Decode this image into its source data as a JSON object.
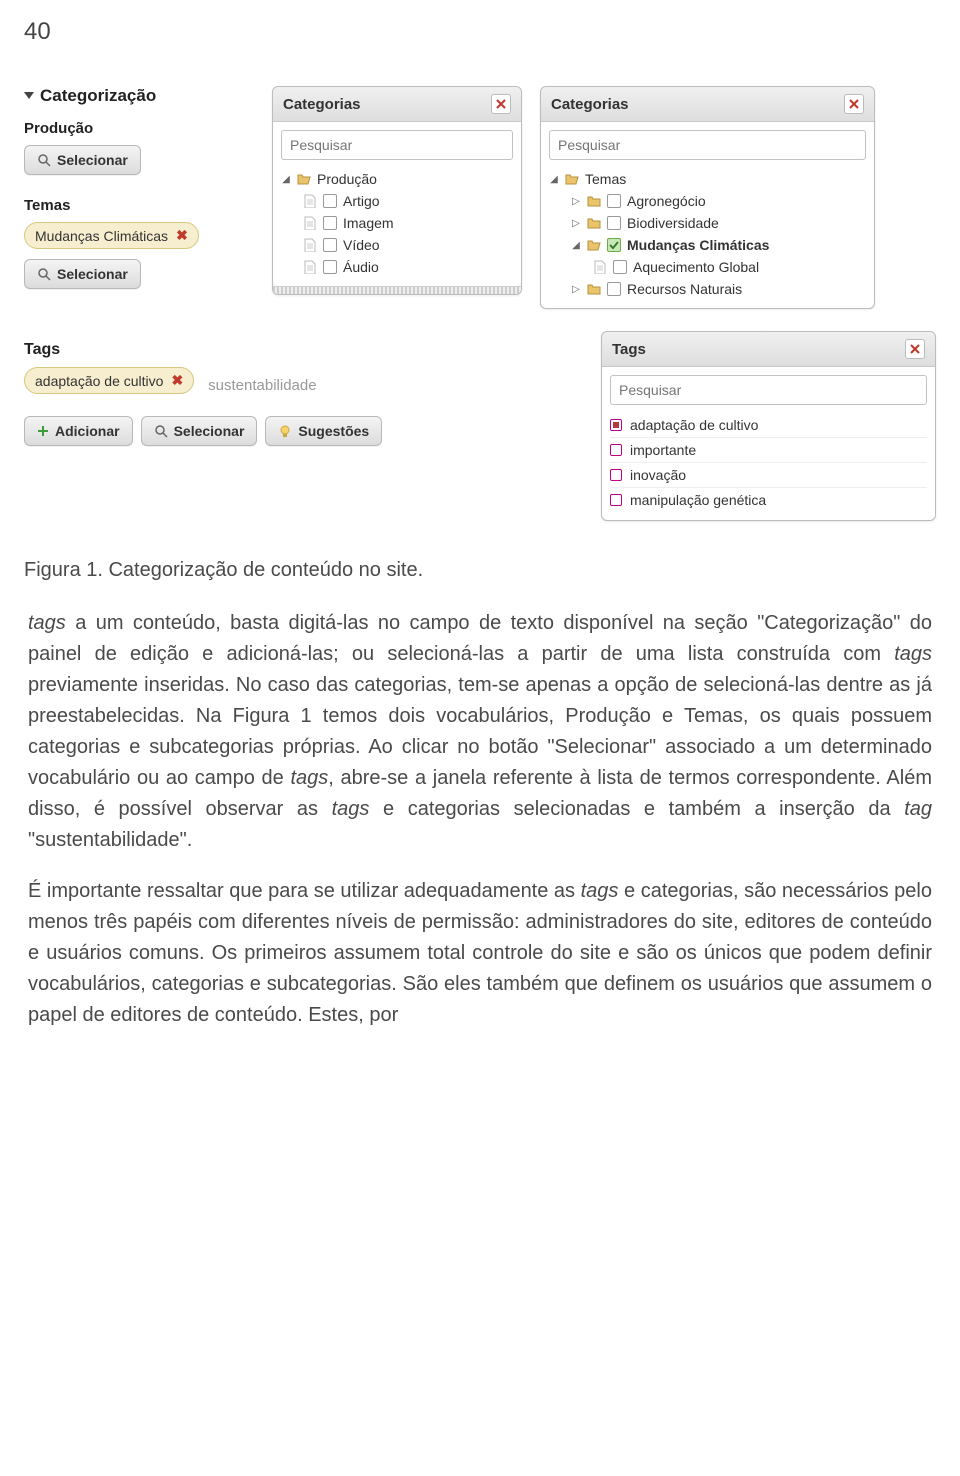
{
  "page_number": "40",
  "categorization": {
    "title": "Categorização",
    "producao_label": "Produção",
    "selecionar_label": "Selecionar",
    "temas_label": "Temas",
    "selected_tema": "Mudanças Climáticas"
  },
  "categorias_panel_left": {
    "title": "Categorias",
    "search_placeholder": "Pesquisar",
    "root": "Produção",
    "items": [
      "Artigo",
      "Imagem",
      "Vídeo",
      "Áudio"
    ]
  },
  "categorias_panel_right": {
    "title": "Categorias",
    "search_placeholder": "Pesquisar",
    "root": "Temas",
    "items": {
      "agronegocio": "Agronegócio",
      "biodiversidade": "Biodiversidade",
      "mudancas": "Mudanças Climáticas",
      "aquecimento": "Aquecimento Global",
      "recursos": "Recursos Naturais"
    }
  },
  "tags": {
    "title": "Tags",
    "selected": "adaptação de cultivo",
    "input_ghost": "sustentabilidade",
    "adicionar": "Adicionar",
    "selecionar": "Selecionar",
    "sugestoes": "Sugestões"
  },
  "tags_panel": {
    "title": "Tags",
    "search_placeholder": "Pesquisar",
    "items": [
      "adaptação de cultivo",
      "importante",
      "inovação",
      "manipulação genética"
    ]
  },
  "caption": "Figura 1. Categorização de conteúdo no site.",
  "body_para1_html": "<em>tags</em> a um conteúdo, basta digitá-las no campo de texto disponível na seção \"Categorização\" do painel de edição e adicioná-las; ou selecioná-las a partir de uma lista construída com <em>tags</em> previamente inseridas. No caso das categorias, tem-se apenas a opção de selecioná-las dentre as já preestabelecidas. Na Figura 1 temos dois vocabulários, Produção e Temas, os quais possuem categorias e subcategorias próprias. Ao clicar no botão \"Selecionar\" associado a um determinado vocabulário ou ao campo de <em>tags</em>, abre-se a janela referente à lista de termos correspondente. Além disso, é possível observar as <em>tags</em> e categorias selecionadas e também a inserção da <em>tag</em> \"sustentabilidade\".",
  "body_para2_html": "É importante ressaltar que para se utilizar adequadamente as <em>tags</em> e categorias, são necessários pelo menos três papéis com diferentes níveis de permissão: administradores do site, editores de conteúdo e usuários comuns. Os primeiros assumem total controle do site e são os únicos que podem definir vocabulários, categorias e subcategorias. São eles também que definem os usuários que assumem o papel de editores de conteúdo. Estes, por"
}
